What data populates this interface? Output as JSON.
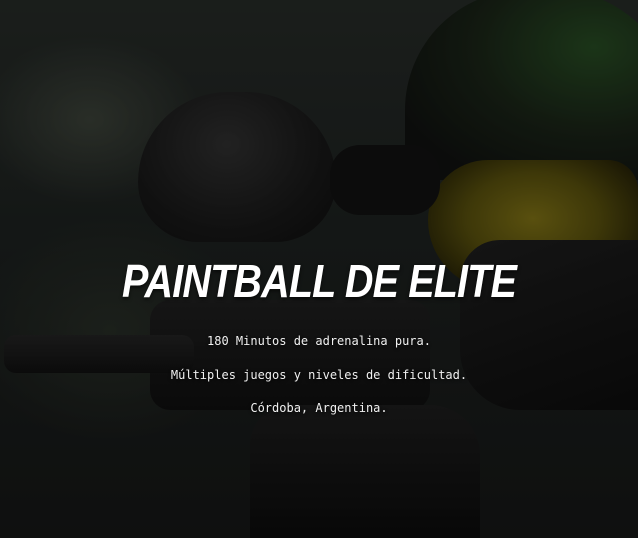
{
  "hero": {
    "title": "PAINTBALL DE ELITE",
    "lines": [
      "180 Minutos de adrenalina pura.",
      "Múltiples juegos y niveles de dificultad.",
      "Córdoba, Argentina."
    ]
  },
  "colors": {
    "text": "#ffffff",
    "overlay": "rgba(0,0,0,0.42)",
    "visor": "#9a8a1a",
    "helmet_accent": "#2f5b2a"
  }
}
